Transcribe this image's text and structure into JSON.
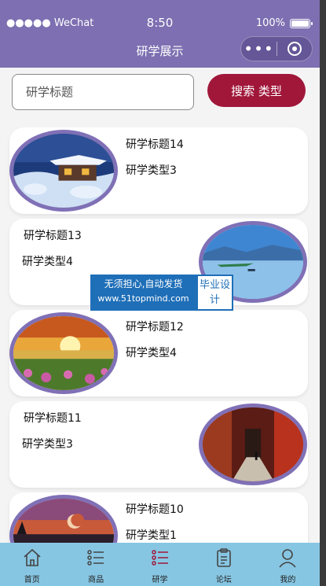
{
  "status_bar": {
    "carrier": "●●●●● WeChat",
    "time": "8:50",
    "battery": "100%"
  },
  "nav": {
    "title": "研学展示",
    "menu_icon": "•••",
    "close_icon": "target-icon"
  },
  "search": {
    "placeholder": "研学标题",
    "button_label": "搜索  类型"
  },
  "items": [
    {
      "title": "研学标题14",
      "type": "研学类型3",
      "image": "snow-house"
    },
    {
      "title": "研学标题13",
      "type": "研学类型4",
      "image": "lake"
    },
    {
      "title": "研学标题12",
      "type": "研学类型4",
      "image": "sunset-field"
    },
    {
      "title": "研学标题11",
      "type": "研学类型3",
      "image": "corridor"
    },
    {
      "title": "研学标题10",
      "type": "研学类型1",
      "image": "moon-dusk"
    }
  ],
  "watermark": {
    "line1": "无须担心,自动发货",
    "line2": "www.51topmind.com",
    "badge": "毕业设计"
  },
  "tabs": [
    {
      "label": "首页",
      "icon": "home-icon"
    },
    {
      "label": "商品",
      "icon": "list-icon"
    },
    {
      "label": "研学",
      "icon": "list-active-icon",
      "active_color": "#a0173a"
    },
    {
      "label": "论坛",
      "icon": "clipboard-icon"
    },
    {
      "label": "我的",
      "icon": "user-icon"
    }
  ],
  "colors": {
    "nav_bg": "#7d6fb1",
    "accent": "#a0173a",
    "tabbar_bg": "#87c6e2",
    "thumb_border": "#8070b6"
  }
}
